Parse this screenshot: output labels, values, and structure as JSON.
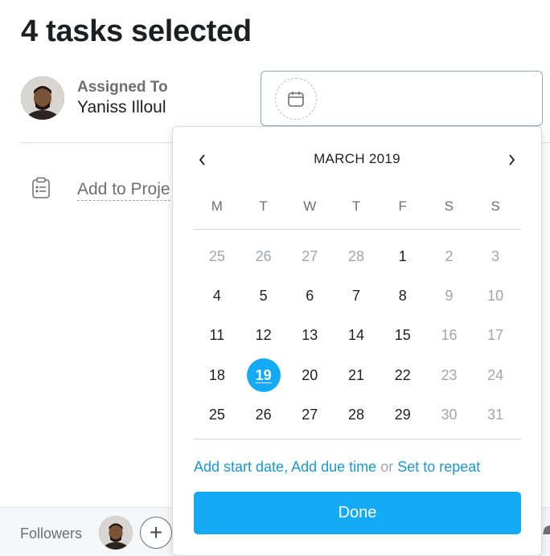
{
  "page": {
    "title": "4 tasks selected"
  },
  "assignee": {
    "label": "Assigned To",
    "name": "Yaniss Illoul"
  },
  "project": {
    "label": "Add to Proje"
  },
  "followers": {
    "label": "Followers",
    "add_label": "+"
  },
  "date_picker": {
    "month_label": "MARCH 2019",
    "prev_label": "‹",
    "next_label": "›",
    "weekdays": [
      "M",
      "T",
      "W",
      "T",
      "F",
      "S",
      "S"
    ],
    "weeks": [
      [
        {
          "d": "25",
          "muted": true
        },
        {
          "d": "26",
          "muted": true
        },
        {
          "d": "27",
          "muted": true
        },
        {
          "d": "28",
          "muted": true
        },
        {
          "d": "1",
          "muted": false
        },
        {
          "d": "2",
          "muted": true
        },
        {
          "d": "3",
          "muted": true
        }
      ],
      [
        {
          "d": "4",
          "muted": false
        },
        {
          "d": "5",
          "muted": false
        },
        {
          "d": "6",
          "muted": false
        },
        {
          "d": "7",
          "muted": false
        },
        {
          "d": "8",
          "muted": false
        },
        {
          "d": "9",
          "muted": true
        },
        {
          "d": "10",
          "muted": true
        }
      ],
      [
        {
          "d": "11",
          "muted": false
        },
        {
          "d": "12",
          "muted": false
        },
        {
          "d": "13",
          "muted": false
        },
        {
          "d": "14",
          "muted": false
        },
        {
          "d": "15",
          "muted": false
        },
        {
          "d": "16",
          "muted": true
        },
        {
          "d": "17",
          "muted": true
        }
      ],
      [
        {
          "d": "18",
          "muted": false
        },
        {
          "d": "19",
          "muted": false,
          "selected": true
        },
        {
          "d": "20",
          "muted": false
        },
        {
          "d": "21",
          "muted": false
        },
        {
          "d": "22",
          "muted": false
        },
        {
          "d": "23",
          "muted": true
        },
        {
          "d": "24",
          "muted": true
        }
      ],
      [
        {
          "d": "25",
          "muted": false
        },
        {
          "d": "26",
          "muted": false
        },
        {
          "d": "27",
          "muted": false
        },
        {
          "d": "28",
          "muted": false
        },
        {
          "d": "29",
          "muted": false
        },
        {
          "d": "30",
          "muted": true
        },
        {
          "d": "31",
          "muted": true
        }
      ]
    ],
    "add_start_date": "Add start date",
    "comma": ",",
    "add_due_time": "Add due time",
    "or_text": "or",
    "set_to_repeat": "Set to repeat",
    "done_label": "Done"
  },
  "colors": {
    "accent": "#14aaf5",
    "link": "#1798d8",
    "muted": "#a2a5a9",
    "text": "#1e1f21"
  },
  "icons": [
    "calendar-icon",
    "clipboard-icon",
    "chevron-left-icon",
    "chevron-right-icon",
    "plus-icon"
  ]
}
